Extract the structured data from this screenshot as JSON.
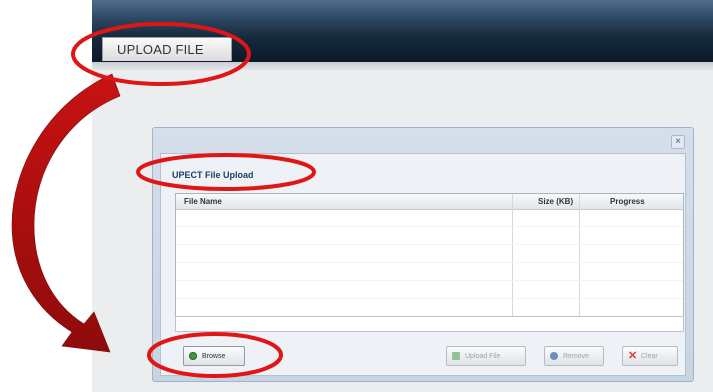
{
  "header": {
    "tab_label": "UPLOAD FILE"
  },
  "dialog": {
    "title": "UPECT File Upload",
    "close_glyph": "×",
    "columns": [
      "File Name",
      "Size (KB)",
      "Progress"
    ],
    "rows": []
  },
  "buttons": {
    "browse": "Browse",
    "upload": "Upload File",
    "remove": "Remove",
    "clear": "Clear"
  },
  "icons": {
    "browse": "browse-icon",
    "upload": "upload-icon",
    "remove": "remove-icon",
    "clear": "clear-icon",
    "close": "close-icon"
  },
  "annotations": {
    "ellipse_color": "#e01515",
    "arrow_color": "#b80d0d"
  }
}
